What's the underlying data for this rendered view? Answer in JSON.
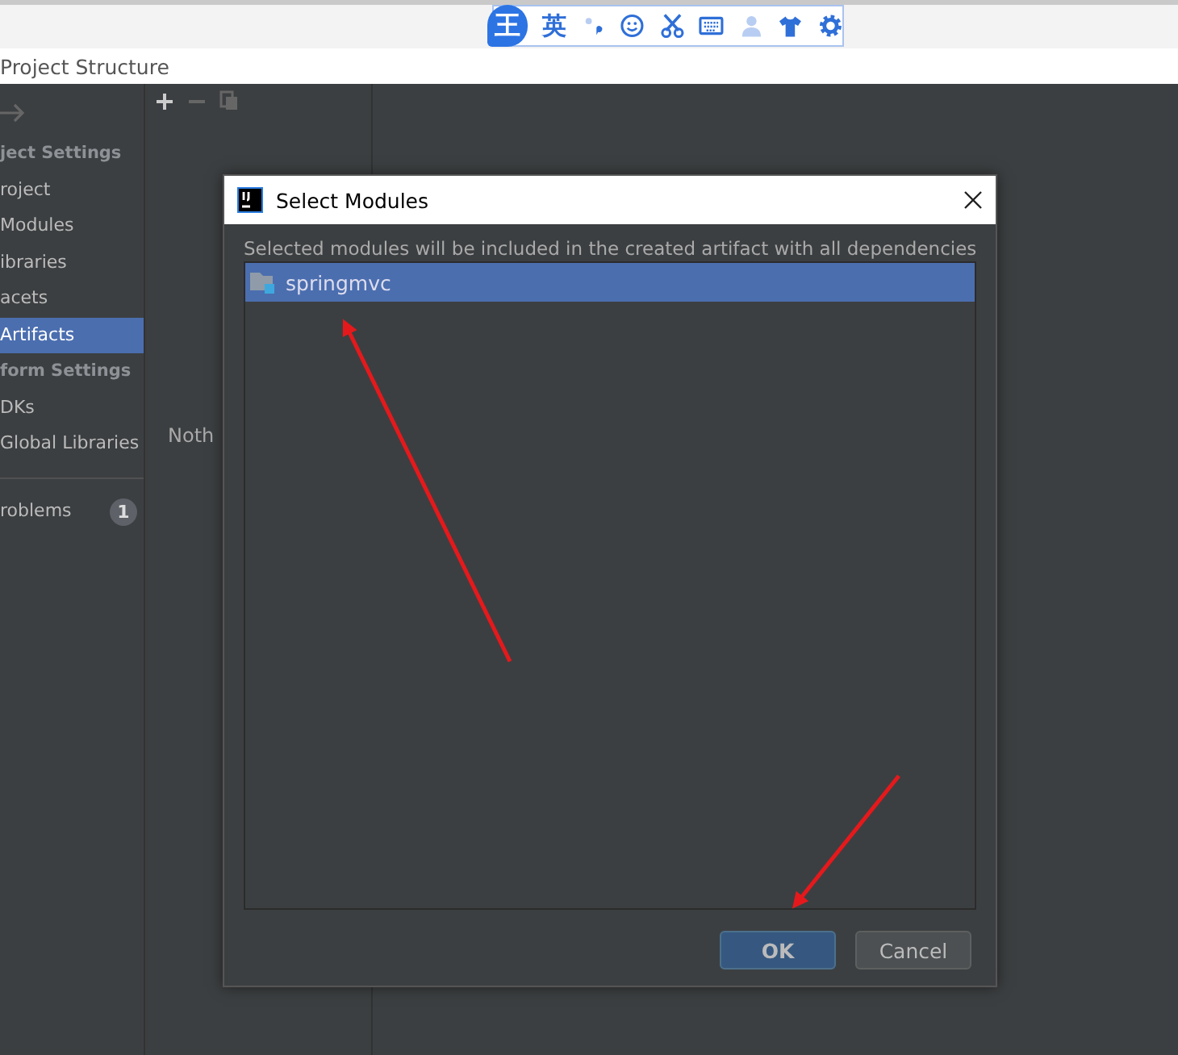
{
  "ime_toolbar": {
    "logo": "王",
    "mode": "英"
  },
  "window": {
    "title": "Project Structure"
  },
  "sidebar": {
    "items": [
      {
        "label": "ject Settings",
        "kind": "header",
        "selected": false
      },
      {
        "label": "roject",
        "kind": "item",
        "selected": false
      },
      {
        "label": "Modules",
        "kind": "item",
        "selected": false
      },
      {
        "label": "ibraries",
        "kind": "item",
        "selected": false
      },
      {
        "label": "acets",
        "kind": "item",
        "selected": false
      },
      {
        "label": "Artifacts",
        "kind": "item",
        "selected": true
      },
      {
        "label": "form Settings",
        "kind": "header",
        "selected": false
      },
      {
        "label": "DKs",
        "kind": "item",
        "selected": false
      },
      {
        "label": "Global Libraries",
        "kind": "item",
        "selected": false
      },
      {
        "label": "roblems",
        "kind": "problems",
        "badge": "1",
        "selected": false
      }
    ]
  },
  "middle_panel": {
    "empty_text": "Noth"
  },
  "dialog": {
    "title": "Select Modules",
    "description": "Selected modules will be included in the created artifact with all dependencies",
    "modules": [
      {
        "name": "springmvc",
        "selected": true
      }
    ],
    "buttons": [
      {
        "label": "OK",
        "kind": "primary"
      },
      {
        "label": "Cancel",
        "kind": "secondary"
      }
    ]
  }
}
